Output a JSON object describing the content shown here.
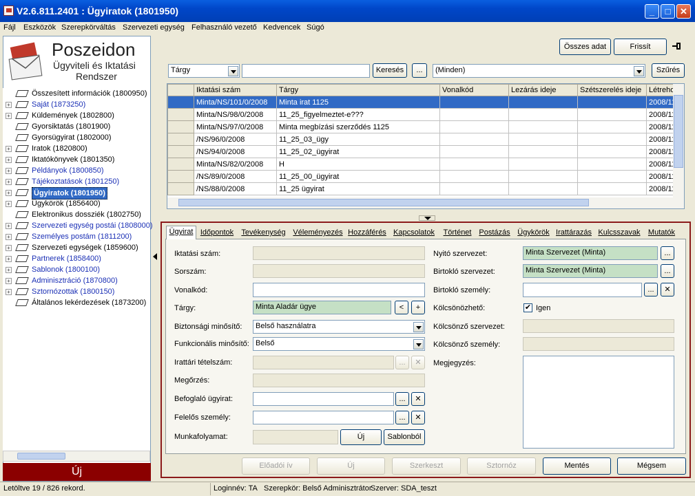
{
  "window": {
    "title": "V2.6.811.2401 : Ügyiratok (1801950)",
    "btn_min": "_",
    "btn_max": "□",
    "btn_close": "✕"
  },
  "menu": [
    "Fájl",
    "Eszközök",
    "Szerepkörváltás",
    "Szervezeti egység",
    "Felhasználó vezető",
    "Kedvencek",
    "Súgó"
  ],
  "logo": {
    "name": "Poszeidon",
    "line1": "Ügyviteli és Iktatási",
    "line2": "Rendszer"
  },
  "tree": [
    {
      "label": "Összesített információk (1800950)",
      "pm": "",
      "style": "",
      "has_expander": false
    },
    {
      "label": "Saját (1873250)",
      "pm": "+",
      "style": "blue",
      "has_expander": true
    },
    {
      "label": "Küldemények (1802800)",
      "pm": "+",
      "style": "",
      "has_expander": true
    },
    {
      "label": "Gyorsiktatás (1801900)",
      "pm": "",
      "style": "",
      "has_expander": false
    },
    {
      "label": "Gyorsügyirat (1802000)",
      "pm": "",
      "style": "",
      "has_expander": false
    },
    {
      "label": "Iratok (1820800)",
      "pm": "+",
      "style": "",
      "has_expander": true
    },
    {
      "label": "Iktatókönyvek (1801350)",
      "pm": "+",
      "style": "",
      "has_expander": true
    },
    {
      "label": "Példányok (1800850)",
      "pm": "+",
      "style": "blue",
      "has_expander": true
    },
    {
      "label": "Tájékoztatások (1801250)",
      "pm": "+",
      "style": "blue",
      "has_expander": true
    },
    {
      "label": "Ügyiratok (1801950)",
      "pm": "+",
      "style": "sel",
      "has_expander": true
    },
    {
      "label": "Ügykörök (1856400)",
      "pm": "+",
      "style": "",
      "has_expander": true
    },
    {
      "label": "Elektronikus dossziék (1802750)",
      "pm": "",
      "style": "",
      "has_expander": false
    },
    {
      "label": "Szervezeti egység postái (1808000)",
      "pm": "+",
      "style": "blue",
      "has_expander": true
    },
    {
      "label": "Személyes postám (1811200)",
      "pm": "+",
      "style": "blue",
      "has_expander": true
    },
    {
      "label": "Szervezeti egységek (1859600)",
      "pm": "+",
      "style": "",
      "has_expander": true
    },
    {
      "label": "Partnerek (1858400)",
      "pm": "+",
      "style": "blue",
      "has_expander": true
    },
    {
      "label": "Sablonok (1800100)",
      "pm": "+",
      "style": "blue",
      "has_expander": true
    },
    {
      "label": "Adminisztráció (1870800)",
      "pm": "+",
      "style": "blue",
      "has_expander": true
    },
    {
      "label": "Sztornózottak (1800150)",
      "pm": "+",
      "style": "blue",
      "has_expander": true
    },
    {
      "label": "Általános lekérdezések (1873200)",
      "pm": "",
      "style": "",
      "has_expander": false
    }
  ],
  "left_new_button": "Új",
  "toolbar": {
    "all_data": "Összes adat",
    "refresh": "Frissít",
    "pin_icon": "pin-icon"
  },
  "search": {
    "field_select": "Tárgy",
    "query": "",
    "search_btn": "Keresés",
    "dots_btn": "...",
    "filter_select": "(Minden)",
    "filter_btn": "Szűrés"
  },
  "grid": {
    "columns": [
      "Iktatási szám",
      "Tárgy",
      "Vonalkód",
      "Lezárás ideje",
      "Szétszerelés ideje",
      "Létreho"
    ],
    "rows": [
      [
        "Minta/NS/101/0/2008",
        "Minta irat 1125",
        "",
        "",
        "",
        "2008/11"
      ],
      [
        "Minta/NS/98/0/2008",
        "11_25_figyelmeztet-e???",
        "",
        "",
        "",
        "2008/11"
      ],
      [
        "Minta/NS/97/0/2008",
        "Minta megbízási szerződés 1125",
        "",
        "",
        "",
        "2008/11"
      ],
      [
        "/NS/96/0/2008",
        "11_25_03_ügy",
        "",
        "",
        "",
        "2008/11"
      ],
      [
        "/NS/94/0/2008",
        "11_25_02_ügyirat",
        "",
        "",
        "",
        "2008/11"
      ],
      [
        "Minta/NS/82/0/2008",
        "H",
        "",
        "",
        "",
        "2008/11"
      ],
      [
        "/NS/89/0/2008",
        "11_25_00_ügyirat",
        "",
        "",
        "",
        "2008/11"
      ],
      [
        "/NS/88/0/2008",
        "11_25 ügyirat",
        "",
        "",
        "",
        "2008/11"
      ]
    ]
  },
  "tabs": [
    "Ügyirat",
    "Időpontok",
    "Tevékenység",
    "Véleményezés",
    "Hozzáférés",
    "Kapcsolatok",
    "Történet",
    "Postázás",
    "Ügykörök",
    "Irattárazás",
    "Kulcsszavak",
    "Mutatók"
  ],
  "form": {
    "iktatasi_szam": {
      "label": "Iktatási szám:",
      "value": ""
    },
    "sorszam": {
      "label": "Sorszám:",
      "value": ""
    },
    "vonalkod": {
      "label": "Vonalkód:",
      "value": ""
    },
    "targy": {
      "label": "Tárgy:",
      "value": "Minta Aladár ügye"
    },
    "biztonsagi": {
      "label": "Biztonsági minősítő:",
      "value": "Belső használatra"
    },
    "funkcionalis": {
      "label": "Funkcionális minősítő:",
      "value": "Belső"
    },
    "irattari": {
      "label": "Irattári tételszám:",
      "value": ""
    },
    "megorzes": {
      "label": "Megőrzés:",
      "value": ""
    },
    "befoglalo": {
      "label": "Befoglaló ügyirat:",
      "value": ""
    },
    "felelos": {
      "label": "Felelős személy:",
      "value": ""
    },
    "munkafolyamat": {
      "label": "Munkafolyamat:",
      "value": "",
      "new_btn": "Új",
      "template_btn": "Sablonból"
    },
    "nyito": {
      "label": "Nyitó szervezet:",
      "value": "Minta Szervezet  (Minta)"
    },
    "birtoklo_szerv": {
      "label": "Birtokló szervezet:",
      "value": "Minta Szervezet  (Minta)"
    },
    "birtoklo_szem": {
      "label": "Birtokló személy:",
      "value": ""
    },
    "kolcsonozheto": {
      "label": "Kölcsönözhető:",
      "check_label": "Igen",
      "checked": true
    },
    "kolcsonzo_szerv": {
      "label": "Kölcsönző szervezet:",
      "value": ""
    },
    "kolcsonzo_szem": {
      "label": "Kölcsönző személy:",
      "value": ""
    },
    "megjegyzes": {
      "label": "Megjegyzés:",
      "value": ""
    },
    "dots": "...",
    "clear": "✕",
    "prev": "<",
    "plus": "+"
  },
  "actions": {
    "eloadoi": "Előadói ív",
    "uj": "Új",
    "szerkeszt": "Szerkeszt",
    "sztornoz": "Sztornóz",
    "mentes": "Mentés",
    "megsem": "Mégsem"
  },
  "status": {
    "records": "Letöltve 19 / 826 rekord.",
    "login": "Loginnév: TA",
    "role": "Szerepkör: Belső Adminisztrátor",
    "server": "Szerver: SDA_teszt"
  }
}
